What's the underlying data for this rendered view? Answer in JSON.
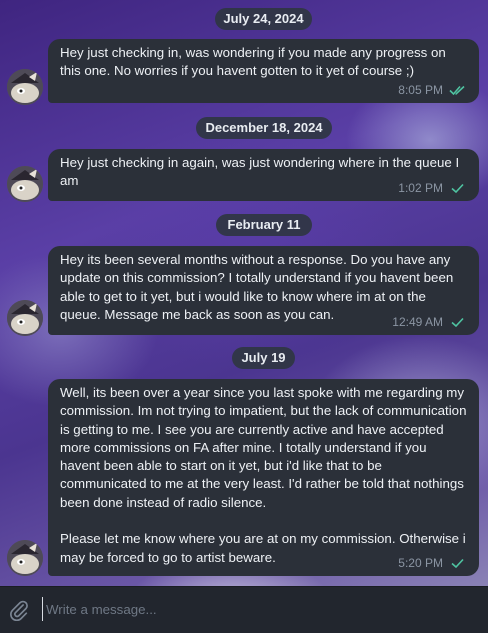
{
  "messages": [
    {
      "date": "July 24, 2024",
      "text": "Hey just checking in, was wondering if you made any progress on this one. No worries if you havent gotten to it yet of course ;)",
      "time": "8:05 PM",
      "status": "read"
    },
    {
      "date": "December 18, 2024",
      "text": "Hey just checking in again, was just wondering where in the queue I am",
      "time": "1:02 PM",
      "status": "sent"
    },
    {
      "date": "February 11",
      "text": "Hey its been several months without a response. Do you have any update on this commission? I totally understand if you havent been able to get to it yet, but i would like to know where im at on the queue. Message me back as soon as you can.",
      "time": "12:49 AM",
      "status": "sent"
    },
    {
      "date": "July 19",
      "text": "Well, its been over a year since you last spoke with me regarding my commission. Im not trying to impatient, but the lack of communication is getting to me. I see you are currently active and have accepted more commissions on FA after mine. I totally understand if you havent been able to start on it yet, but i'd like that to be communicated to me at the very least. I'd rather be told that nothings been done instead of radio silence.\n\nPlease let me know where you are at on my commission. Otherwise i may be forced to go to artist beware.",
      "time": "5:20 PM",
      "status": "sent"
    }
  ],
  "composer": {
    "placeholder": "Write a message..."
  },
  "icons": {
    "attach": "paperclip-icon",
    "read": "double-check-icon",
    "sent": "single-check-icon"
  },
  "colors": {
    "bubble": "#2b3039",
    "check": "#4fc3a1",
    "pill": "#2f3642"
  }
}
